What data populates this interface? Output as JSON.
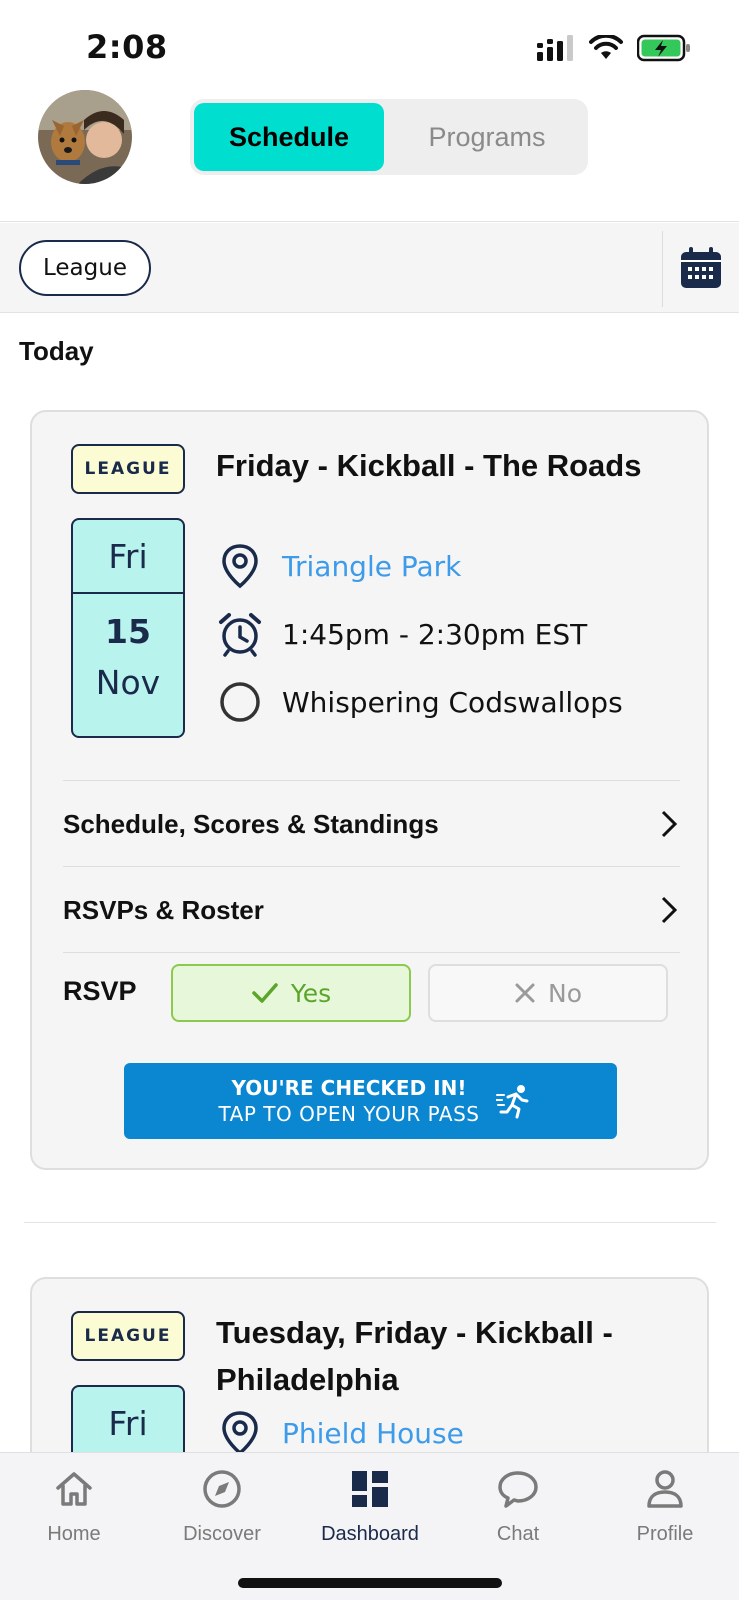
{
  "status": {
    "time": "2:08"
  },
  "header": {
    "tabs": [
      {
        "label": "Schedule",
        "active": true
      },
      {
        "label": "Programs",
        "active": false
      }
    ]
  },
  "filters": {
    "chip": "League",
    "calendar_icon": "calendar-icon"
  },
  "section": {
    "title": "Today"
  },
  "events": [
    {
      "tag": "LEAGUE",
      "dow": "Fri",
      "day": "15",
      "month": "Nov",
      "title": "Friday - Kickball - The Roads",
      "location": "Triangle Park",
      "time": "1:45pm - 2:30pm EST",
      "team": "Whispering Codswallops",
      "links": [
        "Schedule, Scores & Standings",
        "RSVPs & Roster"
      ],
      "rsvp": {
        "label": "RSVP",
        "yes": "Yes",
        "no": "No",
        "selected": "Yes"
      },
      "checkin": {
        "line1": "YOU'RE CHECKED IN!",
        "line2": "TAP TO OPEN YOUR PASS"
      }
    },
    {
      "tag": "LEAGUE",
      "dow": "Fri",
      "title": "Tuesday, Friday - Kickball - Philadelphia",
      "location": "Phield House"
    }
  ],
  "tabbar": {
    "items": [
      {
        "label": "Home",
        "icon": "home-icon"
      },
      {
        "label": "Discover",
        "icon": "compass-icon"
      },
      {
        "label": "Dashboard",
        "icon": "dashboard-icon",
        "active": true
      },
      {
        "label": "Chat",
        "icon": "chat-icon"
      },
      {
        "label": "Profile",
        "icon": "profile-icon"
      }
    ]
  },
  "colors": {
    "accent": "#00dfcf",
    "navy": "#1a2a4a",
    "link": "#3d9be9",
    "checkin": "#0b86d0",
    "yes_green": "#5ba52a"
  }
}
